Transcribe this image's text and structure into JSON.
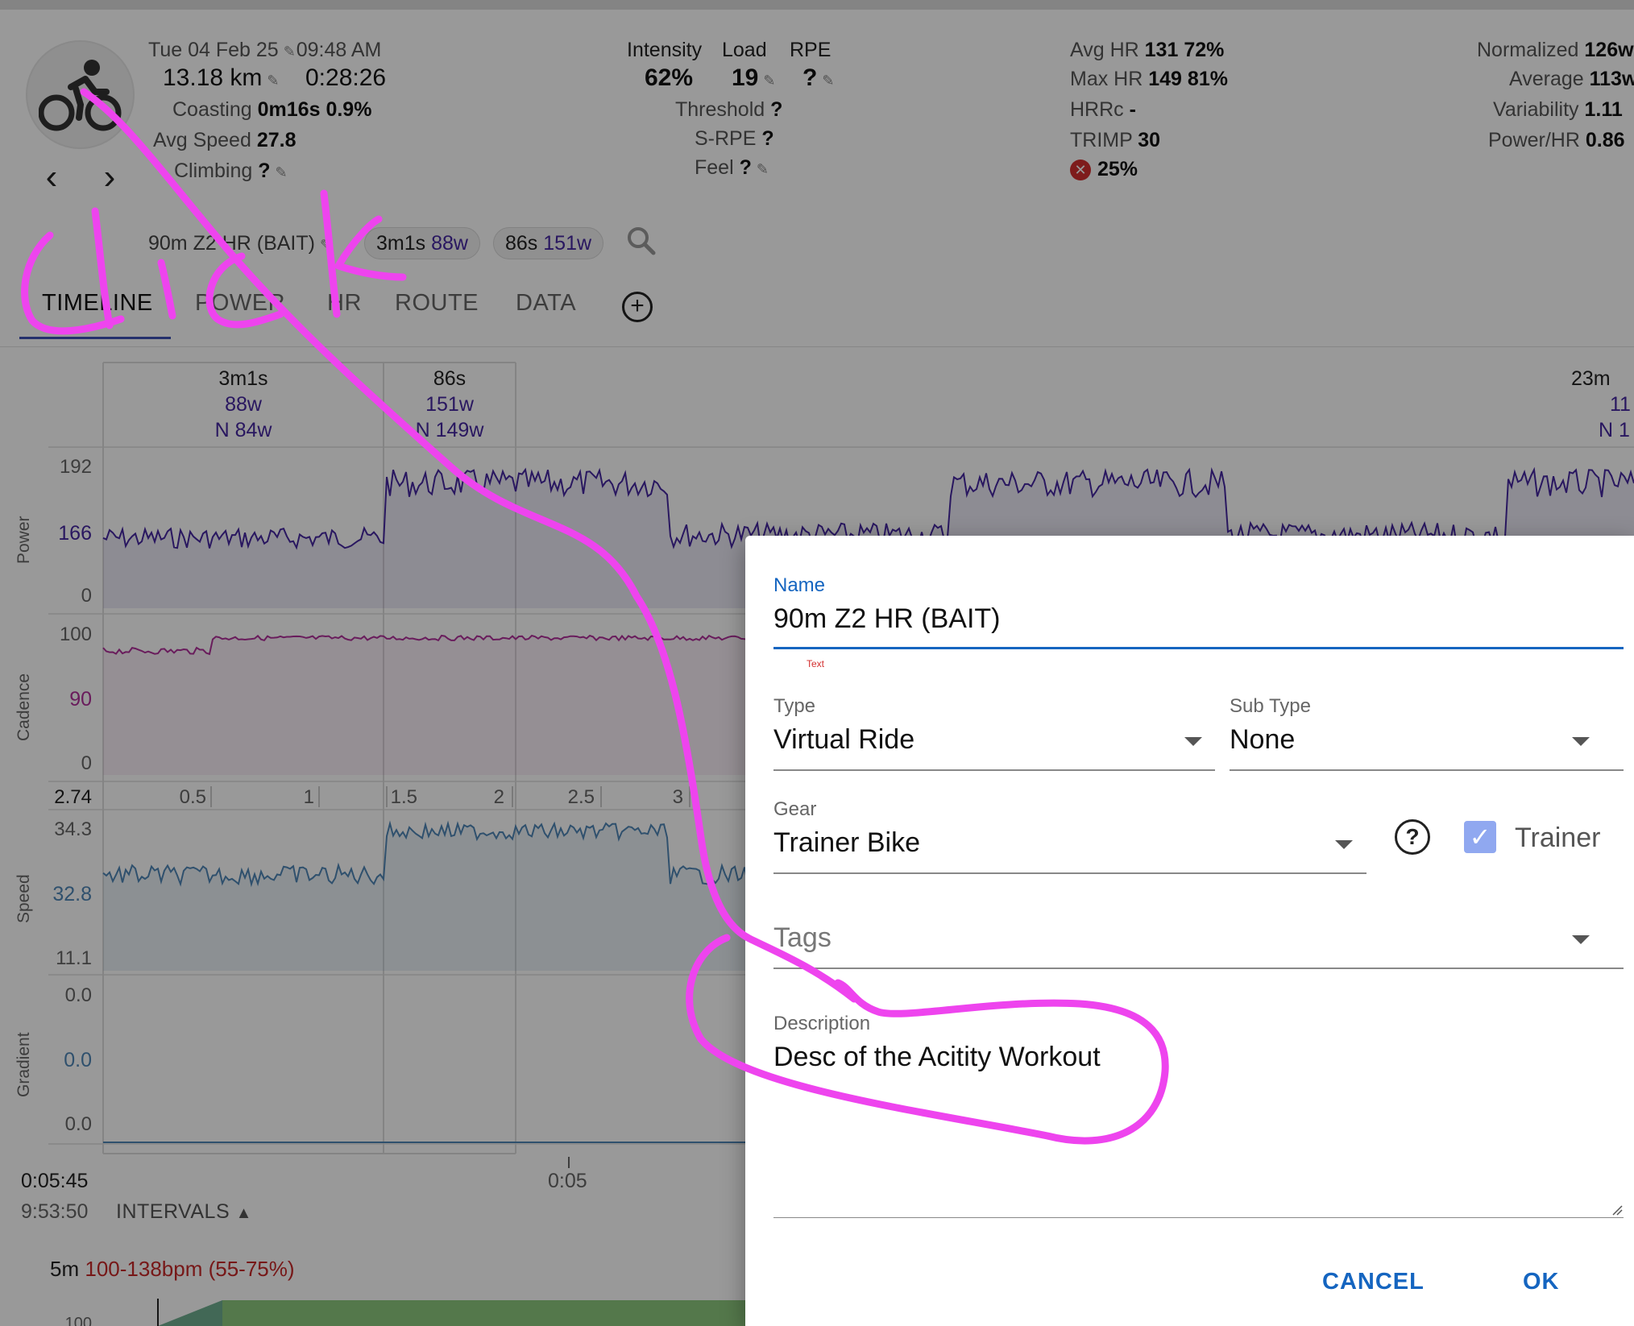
{
  "header": {
    "date": "Tue 04 Feb 25",
    "time": "09:48 AM",
    "distance": "13.18 km",
    "duration": "0:28:26",
    "coasting_label": "Coasting",
    "coasting_value": "0m16s",
    "coasting_pct": "0.9%",
    "avg_speed_label": "Avg Speed",
    "avg_speed_value": "27.8",
    "climbing_label": "Climbing",
    "climbing_value": "?",
    "intensity_label": "Intensity",
    "intensity_value": "62%",
    "load_label": "Load",
    "load_value": "19",
    "rpe_label": "RPE",
    "rpe_value": "?",
    "threshold_label": "Threshold",
    "threshold_value": "?",
    "srpe_label": "S-RPE",
    "srpe_value": "?",
    "feel_label": "Feel",
    "feel_value": "?",
    "avg_hr_label": "Avg HR",
    "avg_hr_value": "131",
    "avg_hr_pct": "72%",
    "max_hr_label": "Max HR",
    "max_hr_value": "149",
    "max_hr_pct": "81%",
    "hrrc_label": "HRRc",
    "hrrc_value": "-",
    "trimp_label": "TRIMP",
    "trimp_value": "30",
    "decoupling_value": "25%",
    "normalized_label": "Normalized",
    "normalized_value": "126w",
    "average_label": "Average",
    "average_value": "113w",
    "variability_label": "Variability",
    "variability_value": "1.11",
    "power_hr_label": "Power/HR",
    "power_hr_value": "0.86"
  },
  "activity_title": "90m Z2 HR (BAIT)",
  "chips": [
    {
      "duration": "3m1s",
      "power": "88w"
    },
    {
      "duration": "86s",
      "power": "151w"
    }
  ],
  "tabs": [
    "TIMELINE",
    "POWER",
    "HR",
    "ROUTE",
    "DATA"
  ],
  "chart": {
    "intervals": [
      {
        "duration": "3m1s",
        "power": "88w",
        "np": "N 84w"
      },
      {
        "duration": "86s",
        "power": "151w",
        "np": "N 149w"
      },
      {
        "duration": "23m",
        "power": "11",
        "np": "N 1"
      }
    ],
    "power": {
      "label": "Power",
      "ticks": [
        "192",
        "166",
        "0"
      ]
    },
    "cadence": {
      "label": "Cadence",
      "ticks": [
        "100",
        "90",
        "0"
      ]
    },
    "distance_axis": [
      "2.74",
      "0.5",
      "1",
      "1.5",
      "2",
      "2.5",
      "3"
    ],
    "speed": {
      "label": "Speed",
      "ticks": [
        "34.3",
        "32.8",
        "11.1"
      ]
    },
    "gradient": {
      "label": "Gradient",
      "ticks": [
        "0.0",
        "0.0",
        "0.0"
      ]
    },
    "time_cursor": "0:05:45",
    "clock_time": "9:53:50",
    "time_tick": "0:05",
    "intervals_button": "INTERVALS",
    "hr_zone_duration": "5m",
    "hr_zone_range": "100-138bpm (55-75%)",
    "bottom_tick": "100"
  },
  "dialog": {
    "name_label": "Name",
    "name_value": "90m Z2 HR (BAIT)",
    "hint": "Text",
    "type_label": "Type",
    "type_value": "Virtual Ride",
    "subtype_label": "Sub Type",
    "subtype_value": "None",
    "gear_label": "Gear",
    "gear_value": "Trainer Bike",
    "trainer_label": "Trainer",
    "trainer_checked": true,
    "tags_placeholder": "Tags",
    "description_label": "Description",
    "description_value": "Desc of the Acitity Workout",
    "cancel": "CANCEL",
    "ok": "OK"
  },
  "annotation": {
    "handwritten": "Click",
    "color": "#ee44ee"
  },
  "colors": {
    "power": "#4527a0",
    "cadence": "#b0309a",
    "speed": "#4f86b6",
    "accent": "#1565c0",
    "hr_range": "#c62828"
  }
}
